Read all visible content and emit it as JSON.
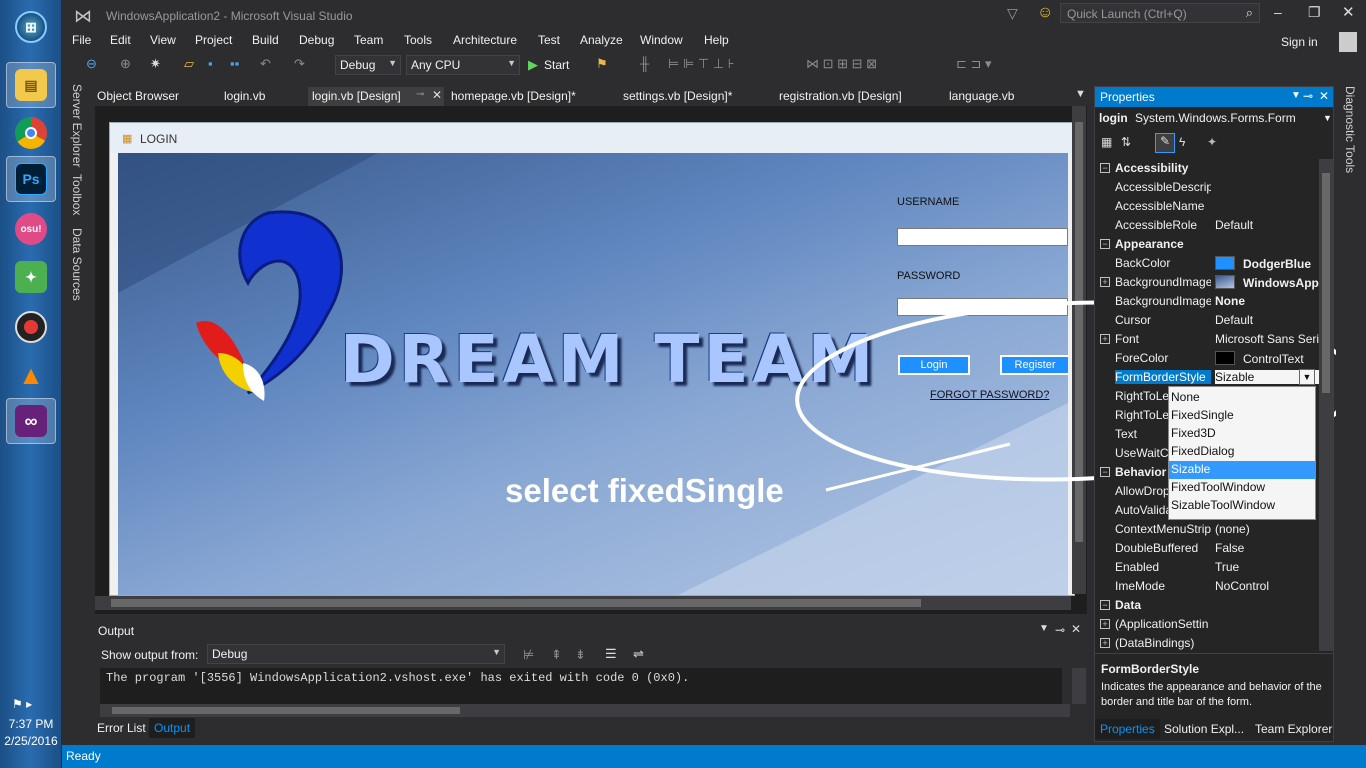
{
  "taskbar": {
    "clock_time": "7:37 PM",
    "clock_date": "2/25/2016",
    "apps": [
      "start-orb-icon",
      "explorer-icon",
      "chrome-icon",
      "photoshop-icon",
      "osu-icon",
      "lime-icon",
      "recorder-icon",
      "vlc-icon",
      "visual-studio-icon"
    ]
  },
  "window": {
    "title": "WindowsApplication2 - Microsoft Visual Studio",
    "quick_launch_placeholder": "Quick Launch (Ctrl+Q)",
    "sign_in": "Sign in"
  },
  "menu": [
    "File",
    "Edit",
    "View",
    "Project",
    "Build",
    "Debug",
    "Team",
    "Tools",
    "Architecture",
    "Test",
    "Analyze",
    "Window",
    "Help"
  ],
  "toolbar": {
    "config": "Debug",
    "platform": "Any CPU",
    "start_label": "Start"
  },
  "side_strip": [
    "Server Explorer",
    "Toolbox",
    "Data Sources"
  ],
  "doc_tabs": [
    {
      "label": "Object Browser"
    },
    {
      "label": "login.vb"
    },
    {
      "label": "login.vb [Design]"
    },
    {
      "label": "homepage.vb [Design]*"
    },
    {
      "label": "settings.vb [Design]*"
    },
    {
      "label": "registration.vb [Design]"
    },
    {
      "label": "language.vb"
    }
  ],
  "login_form": {
    "title": "LOGIN",
    "logo_text": "DREAM TEAM",
    "username_label": "USERNAME",
    "password_label": "PASSWORD",
    "login_button": "Login",
    "register_button": "Register",
    "forgot_link": "FORGOT PASSWORD?"
  },
  "annotation": "select fixedSingle",
  "output": {
    "title": "Output",
    "show_from_label": "Show output from:",
    "show_from_value": "Debug",
    "line": "The program '[3556] WindowsApplication2.vshost.exe' has exited with code 0 (0x0)."
  },
  "bottom_tabs": [
    "Error List",
    "Output"
  ],
  "status": "Ready",
  "diagnostic_tools": "Diagnostic Tools",
  "properties": {
    "title": "Properties",
    "object_name": "login",
    "object_type": "System.Windows.Forms.Form",
    "rows": [
      {
        "type": "cat",
        "name": "Accessibility"
      },
      {
        "name": "AccessibleDescript",
        "value": ""
      },
      {
        "name": "AccessibleName",
        "value": ""
      },
      {
        "name": "AccessibleRole",
        "value": "Default"
      },
      {
        "type": "cat",
        "name": "Appearance"
      },
      {
        "name": "BackColor",
        "value": "DodgerBlue"
      },
      {
        "name": "BackgroundImage",
        "value": "WindowsAppl"
      },
      {
        "name": "BackgroundImage",
        "value": "None"
      },
      {
        "name": "Cursor",
        "value": "Default"
      },
      {
        "name": "Font",
        "value": "Microsoft Sans Serif"
      },
      {
        "name": "ForeColor",
        "value": "ControlText"
      },
      {
        "name": "FormBorderStyle",
        "value": "Sizable"
      },
      {
        "name": "RightToLe",
        "value": ""
      },
      {
        "name": "RightToLe",
        "value": ""
      },
      {
        "name": "Text",
        "value": ""
      },
      {
        "name": "UseWaitCu",
        "value": ""
      },
      {
        "type": "cat",
        "name": "Behavior"
      },
      {
        "name": "AllowDrop",
        "value": ""
      },
      {
        "name": "AutoValida",
        "value": ""
      },
      {
        "name": "ContextMenuStrip",
        "value": "(none)"
      },
      {
        "name": "DoubleBuffered",
        "value": "False"
      },
      {
        "name": "Enabled",
        "value": "True"
      },
      {
        "name": "ImeMode",
        "value": "NoControl"
      },
      {
        "type": "cat",
        "name": "Data"
      },
      {
        "name": "(ApplicationSettin",
        "value": ""
      },
      {
        "name": "(DataBindings)",
        "value": ""
      }
    ],
    "dropdown": [
      "None",
      "FixedSingle",
      "Fixed3D",
      "FixedDialog",
      "Sizable",
      "FixedToolWindow",
      "SizableToolWindow"
    ],
    "desc_title": "FormBorderStyle",
    "desc_text": "Indicates the appearance and behavior of the border and title bar of the form.",
    "tabs": [
      "Properties",
      "Solution Expl...",
      "Team Explorer"
    ]
  },
  "colors": {
    "accent": "#007acc",
    "backcolor_swatch": "#1e90ff",
    "forecolor_swatch": "#000000"
  }
}
